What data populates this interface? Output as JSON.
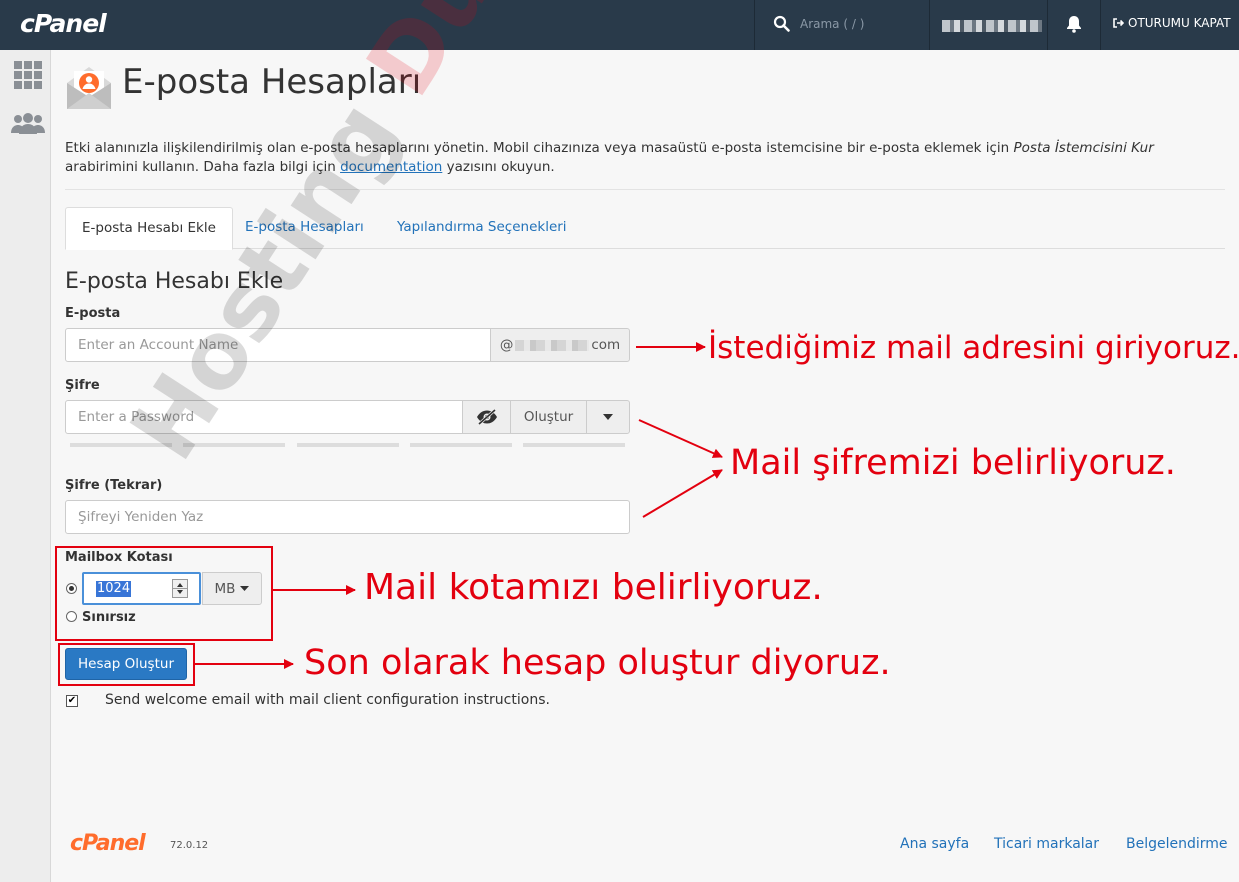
{
  "topbar": {
    "brand": "cPanel",
    "search_placeholder": "Arama ( / )",
    "logout_label": "OTURUMU KAPAT"
  },
  "page": {
    "title": "E-posta Hesapları",
    "intro_part1": "Etki alanınızla ilişkilendirilmiş olan e-posta hesaplarını yönetin. Mobil cihazınıza veya masaüstü e-posta istemcisine bir e-posta eklemek için ",
    "intro_italic": "Posta İstemcisini Kur",
    "intro_part2": " arabirimini kullanın. Daha fazla bilgi için ",
    "intro_link": "documentation",
    "intro_part3": " yazısını okuyun."
  },
  "tabs": [
    {
      "label": "E-posta Hesabı Ekle"
    },
    {
      "label": "E-posta Hesapları"
    },
    {
      "label": "Yapılandırma Seçenekleri"
    }
  ],
  "form": {
    "section_title": "E-posta Hesabı Ekle",
    "email_label": "E-posta",
    "email_placeholder": "Enter an Account Name",
    "domain_prefix": "@",
    "domain_suffix": "com",
    "password_label": "Şifre",
    "password_placeholder": "Enter a Password",
    "generate_label": "Oluştur",
    "password_repeat_label": "Şifre (Tekrar)",
    "password_repeat_placeholder": "Şifreyi Yeniden Yaz",
    "quota_label": "Mailbox Kotası",
    "quota_value": "1024",
    "quota_unit": "MB",
    "unlimited_label": "Sınırsız",
    "submit_label": "Hesap Oluştur",
    "welcome_label": "Send welcome email with mail client configuration instructions."
  },
  "annotations": {
    "email": "İstediğimiz mail adresini giriyoruz.",
    "password": "Mail şifremizi belirliyoruz.",
    "quota": "Mail kotamızı belirliyoruz.",
    "submit": "Son olarak hesap oluştur diyoruz."
  },
  "watermark": {
    "part1": "Hosting ",
    "part2": "Dünyam"
  },
  "footer": {
    "logo": "cPanel",
    "version": "72.0.12",
    "links": [
      {
        "label": "Ana sayfa"
      },
      {
        "label": "Ticari markalar"
      },
      {
        "label": "Belgelendirme"
      }
    ]
  },
  "colors": {
    "topbar": "#293a4a",
    "link": "#2272b9",
    "primary": "#2a79c4",
    "annotation": "#e3000f",
    "footer_logo": "#ff6c2c"
  }
}
